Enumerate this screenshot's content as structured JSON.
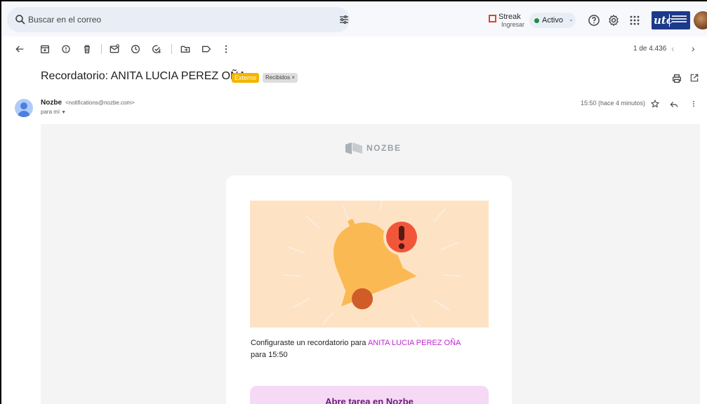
{
  "search": {
    "placeholder": "Buscar en el correo"
  },
  "streak": {
    "title": "Streak",
    "action": "Ingresar"
  },
  "status": {
    "label": "Activo",
    "color": "#1e8e3e"
  },
  "toolbar": {
    "icons": [
      "back-icon",
      "archive-icon",
      "report-spam-icon",
      "delete-icon",
      "mark-unread-icon",
      "snooze-icon",
      "add-task-icon",
      "move-to-icon",
      "label-icon",
      "more-icon"
    ],
    "pager": "1 de 4.436"
  },
  "email": {
    "subject": "Recordatorio: ANITA LUCIA PEREZ OÑA",
    "badge_external": "Externo",
    "badge_inbox": "Recibidos ×",
    "sender_name": "Nozbe",
    "sender_email": "<notifications@nozbe.com>",
    "to": "para mí",
    "time": "15:50 (hace 4 minutos)"
  },
  "body": {
    "brand": "NOZBE",
    "message_prefix": "Configuraste un recordatorio para ",
    "message_task": "ANITA LUCIA PEREZ OÑA",
    "message_suffix": "para 15:50",
    "cta": "Abre tarea en Nozbe"
  },
  "colors": {
    "accent_task": "#c026d3",
    "badge_external": "#f4b400",
    "hero_bg": "#fde3c4",
    "cta_bg": "#f5d9f5"
  }
}
